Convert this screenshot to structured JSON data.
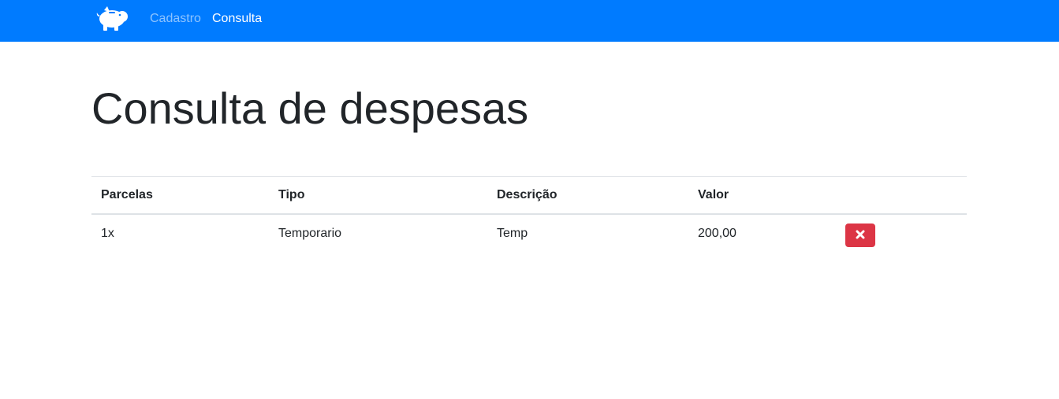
{
  "navbar": {
    "brand_icon": "piggy-bank-icon",
    "links": [
      {
        "label": "Cadastro",
        "active": false
      },
      {
        "label": "Consulta",
        "active": true
      }
    ],
    "color": "#007bff"
  },
  "main": {
    "title": "Consulta de despesas",
    "table": {
      "headers": [
        "Parcelas",
        "Tipo",
        "Descrição",
        "Valor"
      ],
      "rows": [
        {
          "parcelas": "1x",
          "tipo": "Temporario",
          "descricao": "Temp",
          "valor": "200,00",
          "action_icon": "close-icon"
        }
      ]
    },
    "delete_button_color": "#dc3545"
  }
}
